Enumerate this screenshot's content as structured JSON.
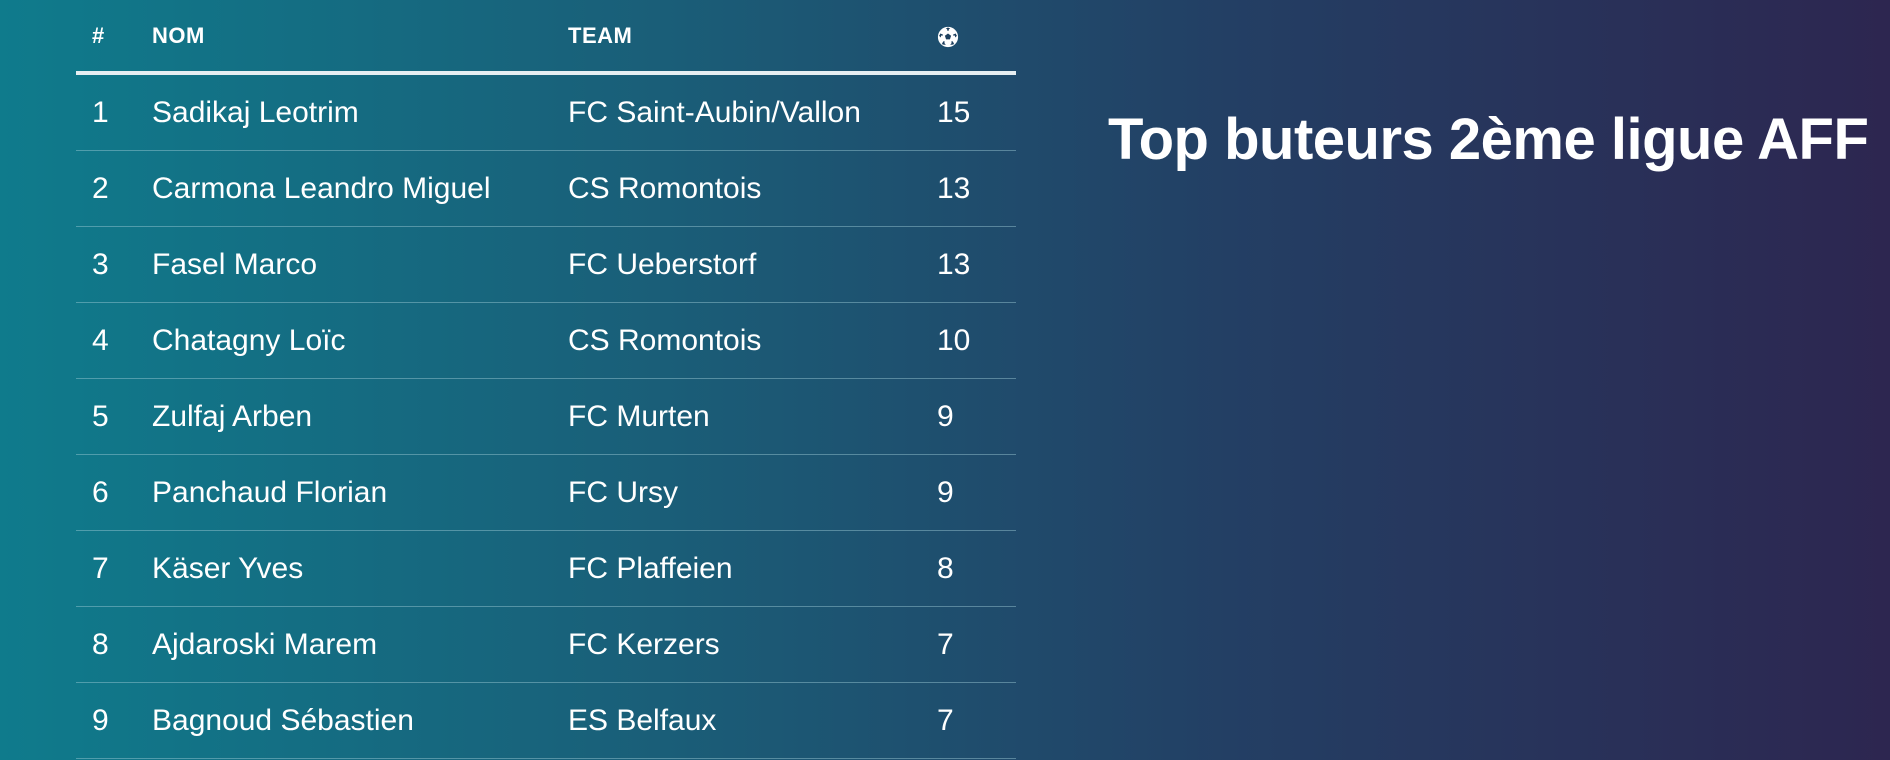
{
  "title": "Top buteurs 2ème ligue AFF",
  "table": {
    "headers": {
      "rank": "#",
      "name": "NOM",
      "team": "TEAM",
      "goals_icon": "soccer-ball-icon"
    },
    "rows": [
      {
        "rank": "1",
        "name": "Sadikaj Leotrim",
        "team": "FC Saint-Aubin/Vallon",
        "goals": "15"
      },
      {
        "rank": "2",
        "name": "Carmona Leandro Miguel",
        "team": "CS Romontois",
        "goals": "13"
      },
      {
        "rank": "3",
        "name": "Fasel Marco",
        "team": "FC Ueberstorf",
        "goals": "13"
      },
      {
        "rank": "4",
        "name": "Chatagny Loïc",
        "team": "CS Romontois",
        "goals": "10"
      },
      {
        "rank": "5",
        "name": "Zulfaj Arben",
        "team": "FC Murten",
        "goals": "9"
      },
      {
        "rank": "6",
        "name": "Panchaud Florian",
        "team": "FC Ursy",
        "goals": "9"
      },
      {
        "rank": "7",
        "name": "Käser Yves",
        "team": "FC Plaffeien",
        "goals": "8"
      },
      {
        "rank": "8",
        "name": "Ajdaroski Marem",
        "team": "FC Kerzers",
        "goals": "7"
      },
      {
        "rank": "9",
        "name": "Bagnoud Sébastien",
        "team": "ES Belfaux",
        "goals": "7"
      }
    ]
  },
  "colors": {
    "gradient_start": "#0f7b8c",
    "gradient_end": "#2d2650",
    "text": "#ffffff"
  }
}
